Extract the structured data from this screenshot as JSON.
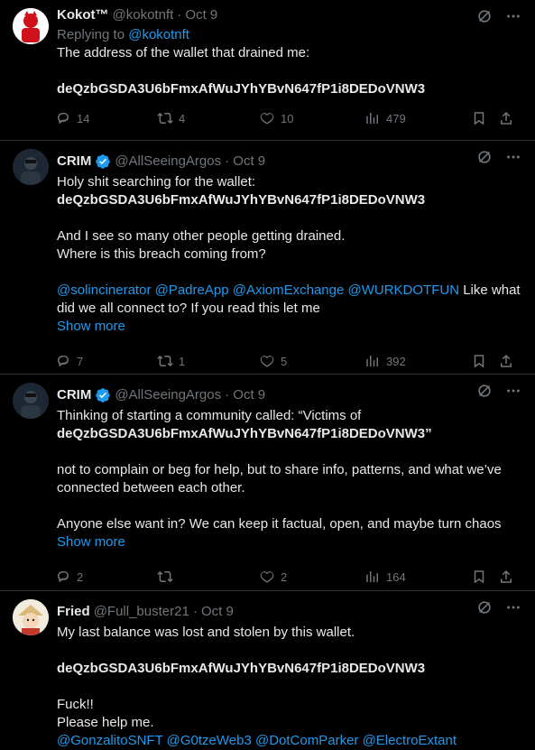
{
  "tweets": [
    {
      "name": "Kokot™",
      "handle": "@kokotnft",
      "date": "· Oct 9",
      "replying_prefix": "Replying to ",
      "replying_to": "@kokotnft",
      "lines": [
        "The address of the wallet that drained me:"
      ],
      "address": "deQzbGSDA3U6bFmxAfWuJYhYBvN647fP1i8DEDoVNW3",
      "replies": "14",
      "reposts": "4",
      "likes": "10",
      "views": "479"
    },
    {
      "name": "CRIM",
      "handle": "@AllSeeingArgos",
      "date": "· Oct 9",
      "line1": "Holy shit searching for the wallet:",
      "address": "deQzbGSDA3U6bFmxAfWuJYhYBvN647fP1i8DEDoVNW3",
      "line2": "And I see so many other people getting drained.",
      "line3": "Where is this breach coming from?",
      "mentions": "@solincinerator @PadreApp @AxiomExchange @WURKDOTFUN",
      "line4_tail": " Like what",
      "line5": "did we all connect to? If you read this let me",
      "show_more": "Show more",
      "replies": "7",
      "reposts": "1",
      "likes": "5",
      "views": "392"
    },
    {
      "name": "CRIM",
      "handle": "@AllSeeingArgos",
      "date": "· Oct 9",
      "line1": "Thinking of starting a community called: “Victims of",
      "address_quoted": "deQzbGSDA3U6bFmxAfWuJYhYBvN647fP1i8DEDoVNW3”",
      "line2": "not to complain or beg for help, but to share info, patterns, and what we’ve",
      "line3": "connected between each other.",
      "line4": "Anyone else want in? We can keep it factual, open, and maybe turn chaos",
      "show_more": "Show more",
      "replies": "2",
      "reposts": "",
      "likes": "2",
      "views": "164"
    },
    {
      "name": "Fried",
      "handle": "@Full_buster21",
      "date": "· Oct 9",
      "line1": "My last balance was lost and stolen by this wallet.",
      "address": "deQzbGSDA3U6bFmxAfWuJYhYBvN647fP1i8DEDoVNW3",
      "line2": "Fuck!!",
      "line3": "Please help me.",
      "mentions": "@GonzalitoSNFT @G0tzeWeb3 @DotComParker @ElectroExtant"
    }
  ],
  "colors": {
    "accent": "#1d9bf0",
    "muted": "#71767b",
    "text": "#e7e9ea",
    "divider": "#2f3336"
  }
}
